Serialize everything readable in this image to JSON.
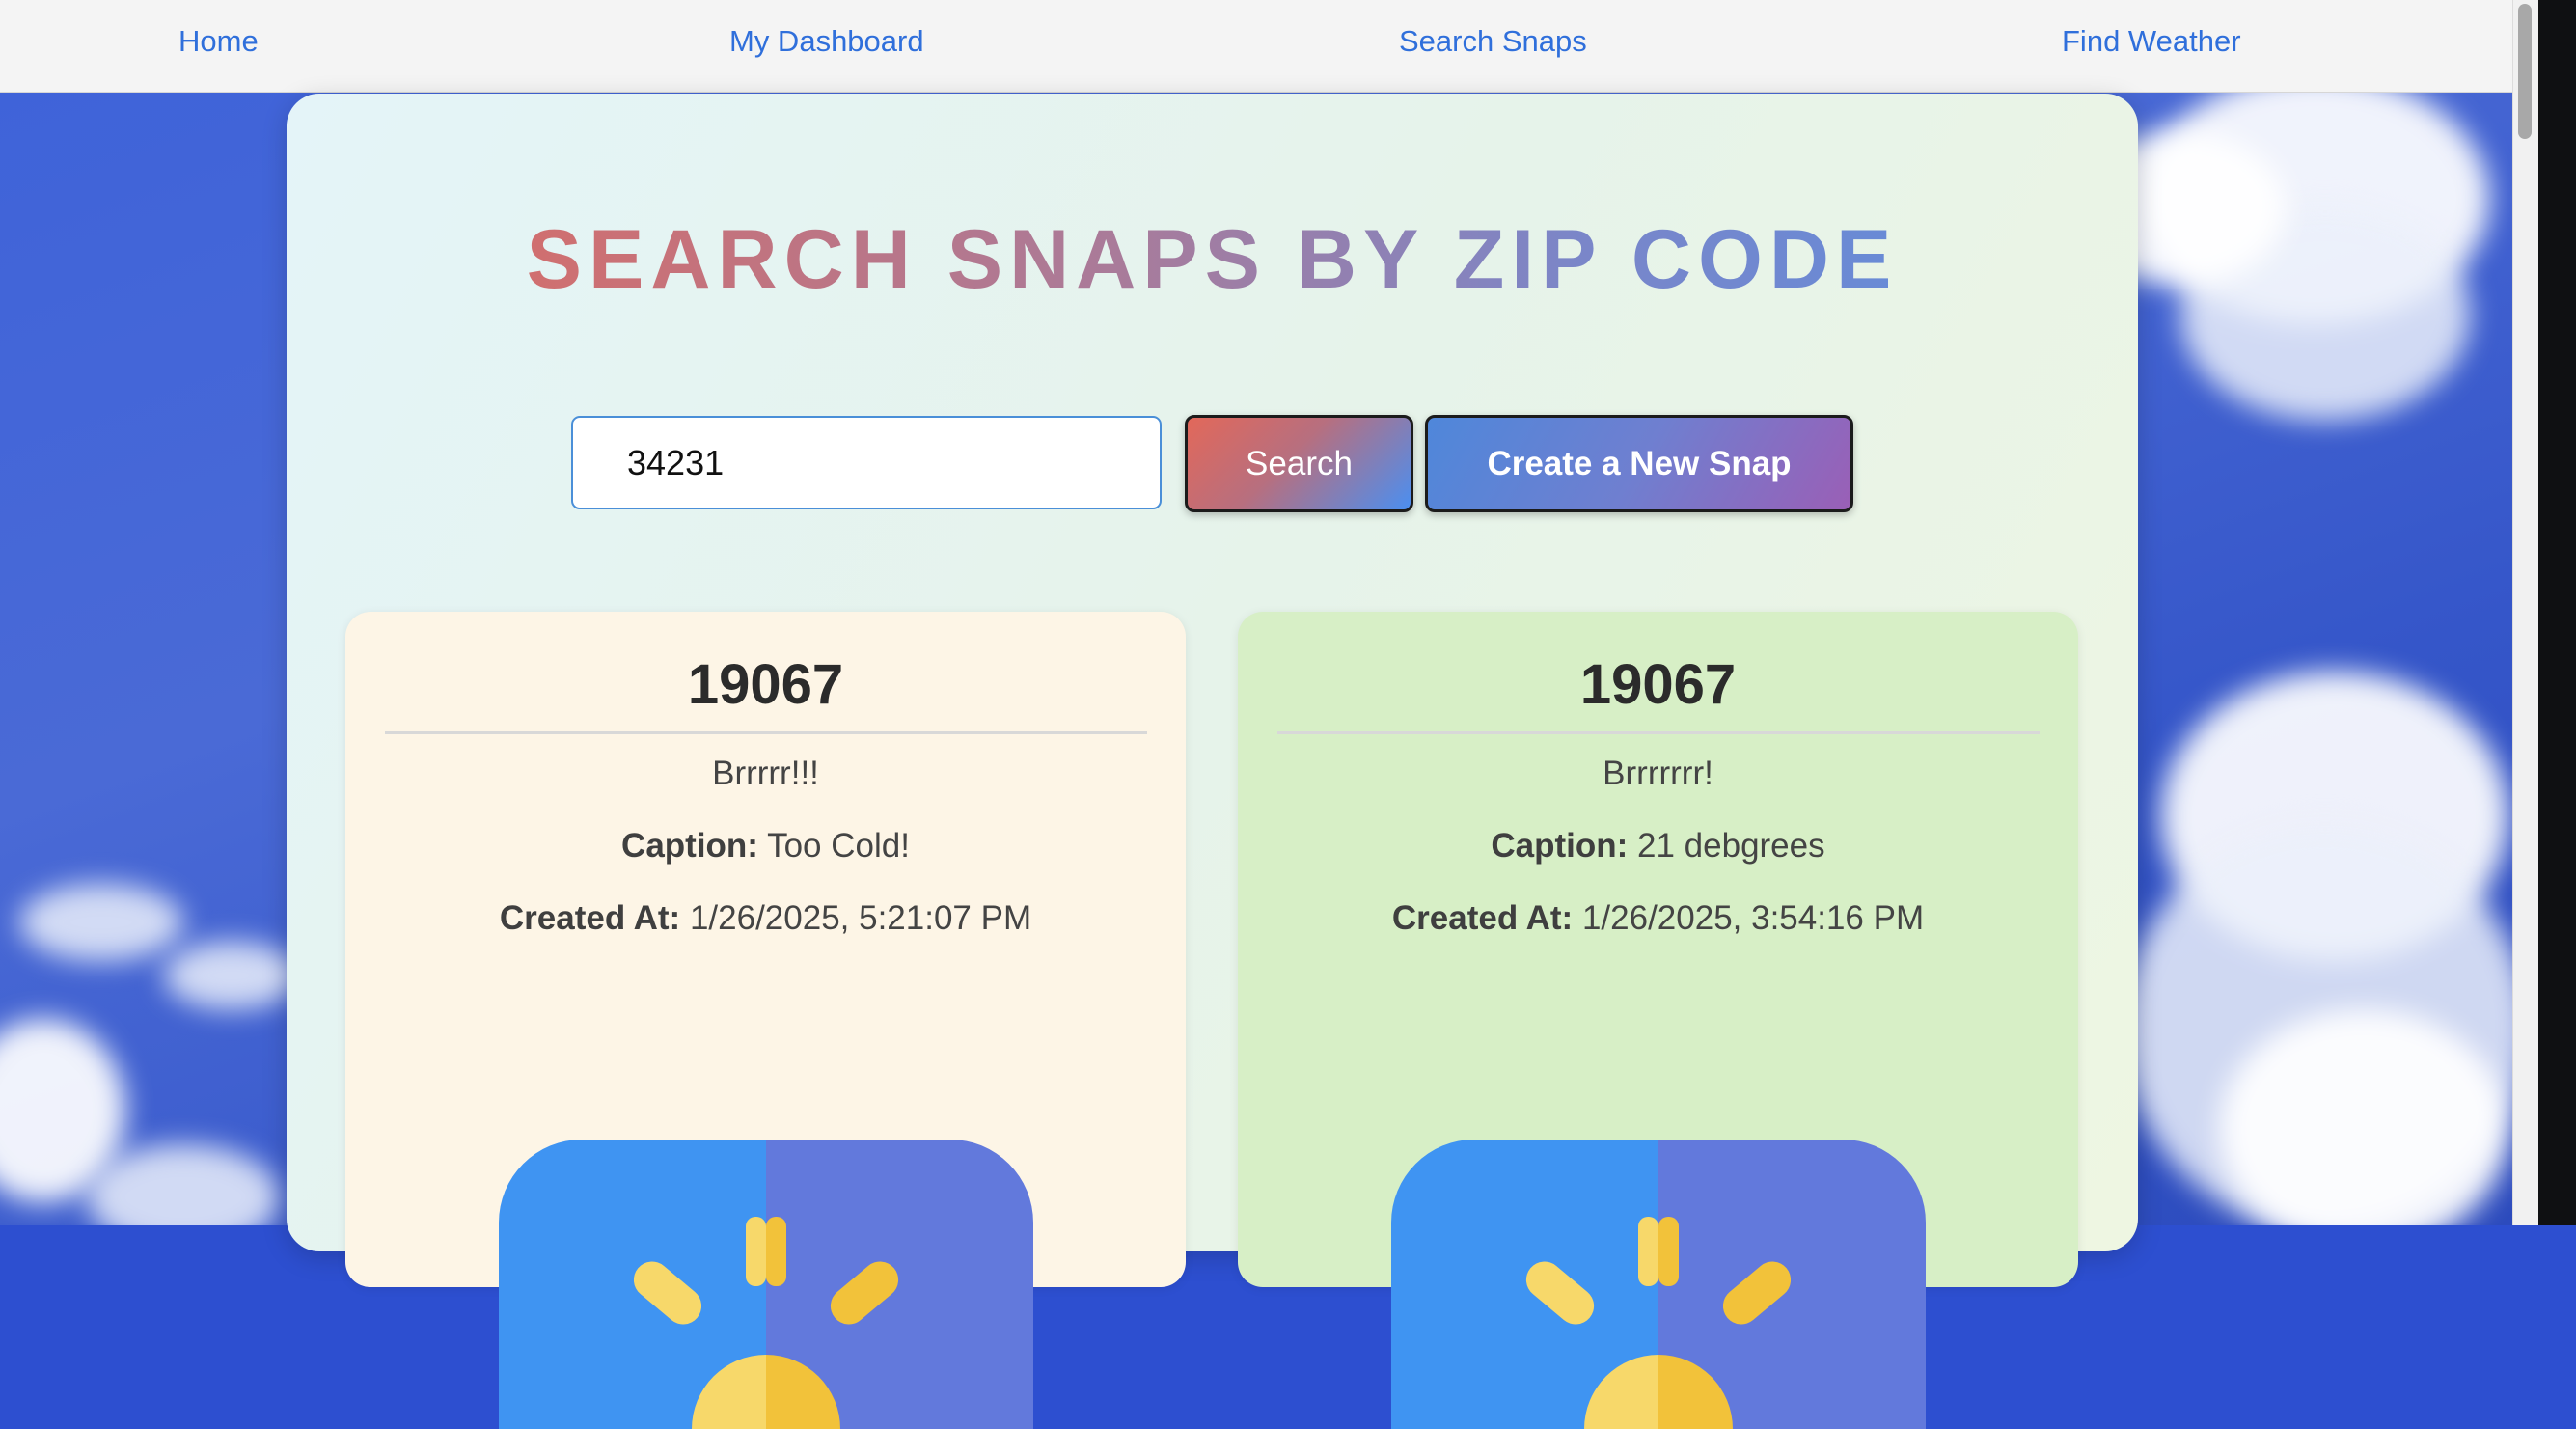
{
  "nav": {
    "home": "Home",
    "dashboard": "My Dashboard",
    "search_snaps": "Search Snaps",
    "find_weather": "Find Weather"
  },
  "page": {
    "title": "SEARCH SNAPS BY ZIP CODE"
  },
  "search": {
    "value": "34231",
    "search_button": "Search",
    "create_button": "Create a New Snap"
  },
  "snaps": [
    {
      "zip": "19067",
      "text": "Brrrrr!!!",
      "caption_label": "Caption:",
      "caption": "Too Cold!",
      "created_label": "Created At:",
      "created_at": "1/26/2025, 5:21:07 PM",
      "icon": "sun-weather-icon"
    },
    {
      "zip": "19067",
      "text": "Brrrrrrr!",
      "caption_label": "Caption:",
      "caption": "21 debgrees",
      "created_label": "Created At:",
      "created_at": "1/26/2025, 3:54:16 PM",
      "icon": "sun-weather-icon"
    }
  ],
  "colors": {
    "nav_link": "#2f6fdb",
    "card1_bg": "#fdf5e6",
    "card2_bg": "#d7efc6",
    "icon_blue": "#3f94f2",
    "icon_indigo": "#6279dc",
    "sun_yellow": "#f7c948"
  }
}
